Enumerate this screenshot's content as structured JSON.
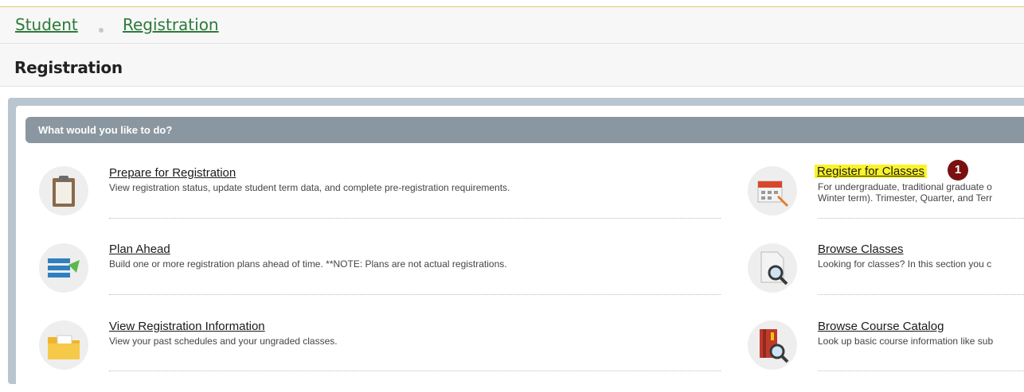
{
  "breadcrumb": {
    "items": [
      "Student",
      "Registration"
    ]
  },
  "page": {
    "title": "Registration"
  },
  "panel": {
    "header": "What would you like to do?"
  },
  "left_items": [
    {
      "title": "Prepare for Registration",
      "description": "View registration status, update student term data, and complete pre-registration requirements.",
      "icon": "clipboard-icon"
    },
    {
      "title": "Plan Ahead",
      "description": "Build one or more registration plans ahead of time. **NOTE: Plans are not actual registrations.",
      "icon": "plan-list-icon"
    },
    {
      "title": "View Registration Information",
      "description": "View your past schedules and your ungraded classes.",
      "icon": "folder-icon"
    }
  ],
  "right_items": [
    {
      "title": "Register for Classes",
      "description_lines": [
        "For undergraduate, traditional graduate o",
        "Winter term). Trimester, Quarter, and Terr"
      ],
      "icon": "calendar-icon"
    },
    {
      "title": "Browse Classes",
      "description": "Looking for classes? In this section you c",
      "icon": "document-search-icon"
    },
    {
      "title": "Browse Course Catalog",
      "description": "Look up basic course information like sub",
      "icon": "book-search-icon"
    }
  ],
  "annotation": {
    "badge": "1",
    "highlight_color": "#fbf32a"
  },
  "colors": {
    "link_green": "#2d7a3a",
    "header_gray": "#8a97a0",
    "badge_red": "#7a1010"
  }
}
